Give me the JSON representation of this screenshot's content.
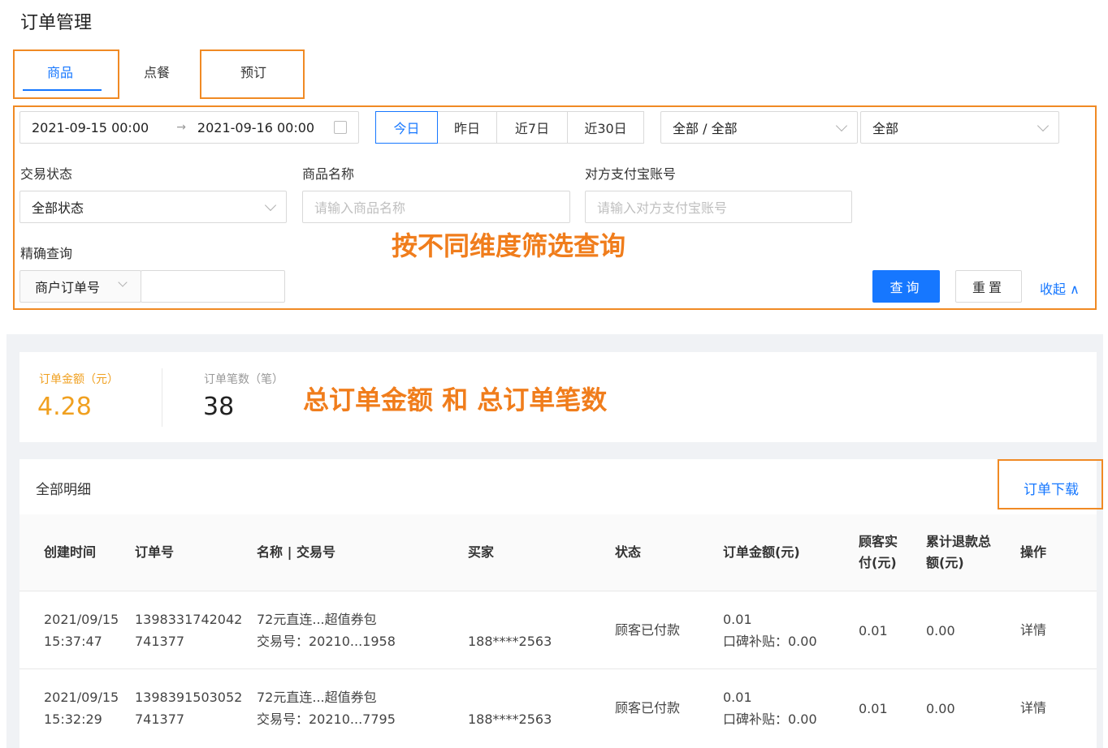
{
  "page_title": "订单管理",
  "tabs": [
    {
      "label": "商品",
      "active": true
    },
    {
      "label": "点餐",
      "active": false
    },
    {
      "label": "预订",
      "active": false
    }
  ],
  "filters": {
    "date_start": "2021-09-15 00:00",
    "date_arrow": "→",
    "date_end": "2021-09-16 00:00",
    "quick_ranges": [
      "今日",
      "昨日",
      "近7日",
      "近30日"
    ],
    "quick_active": "今日",
    "category_select": "全部 / 全部",
    "scope_select": "全部",
    "trade_status_label": "交易状态",
    "trade_status_value": "全部状态",
    "product_name_label": "商品名称",
    "product_name_placeholder": "请输入商品名称",
    "alipay_label": "对方支付宝账号",
    "alipay_placeholder": "请输入对方支付宝账号",
    "exact_label": "精确查询",
    "exact_type": "商户订单号",
    "exact_value": "",
    "query_button": "查询",
    "reset_button": "重置",
    "collapse_link": "收起 ∧"
  },
  "annotations": {
    "filter_note": "按不同维度筛选查询",
    "summary_note": "总订单金额 和 总订单笔数"
  },
  "summary": {
    "amount_label": "订单金额（元）",
    "amount_value": "4.28",
    "count_label": "订单笔数（笔）",
    "count_value": "38"
  },
  "detail": {
    "title": "全部明细",
    "download_link": "订单下载",
    "columns": [
      "创建时间",
      "订单号",
      "名称 | 交易号",
      "买家",
      "状态",
      "订单金额(元)",
      "顾客实付(元)",
      "累计退款总额(元)",
      "操作"
    ],
    "columns_split": {
      "paid_1": "顾客实",
      "paid_2": "付(元)",
      "refund_1": "累计退款总",
      "refund_2": "额(元)"
    },
    "rows": [
      {
        "date": "2021/09/15",
        "time": "15:37:47",
        "order_1": "1398331742042",
        "order_2": "741377",
        "name": "72元直连...超值券包",
        "trade_no": "交易号：20210...1958",
        "buyer": "188****2563",
        "status": "顾客已付款",
        "amount": "0.01",
        "subsidy": "口碑补贴：0.00",
        "paid": "0.01",
        "refund": "0.00",
        "action": "详情"
      },
      {
        "date": "2021/09/15",
        "time": "15:32:29",
        "order_1": "1398391503052",
        "order_2": "741377",
        "name": "72元直连...超值券包",
        "trade_no": "交易号：20210...7795",
        "buyer": "188****2563",
        "status": "顾客已付款",
        "amount": "0.01",
        "subsidy": "口碑补贴：0.00",
        "paid": "0.01",
        "refund": "0.00",
        "action": "详情"
      }
    ]
  },
  "colors": {
    "accent": "#1677ff",
    "highlight": "#f08a24",
    "amount": "#f0a020"
  }
}
